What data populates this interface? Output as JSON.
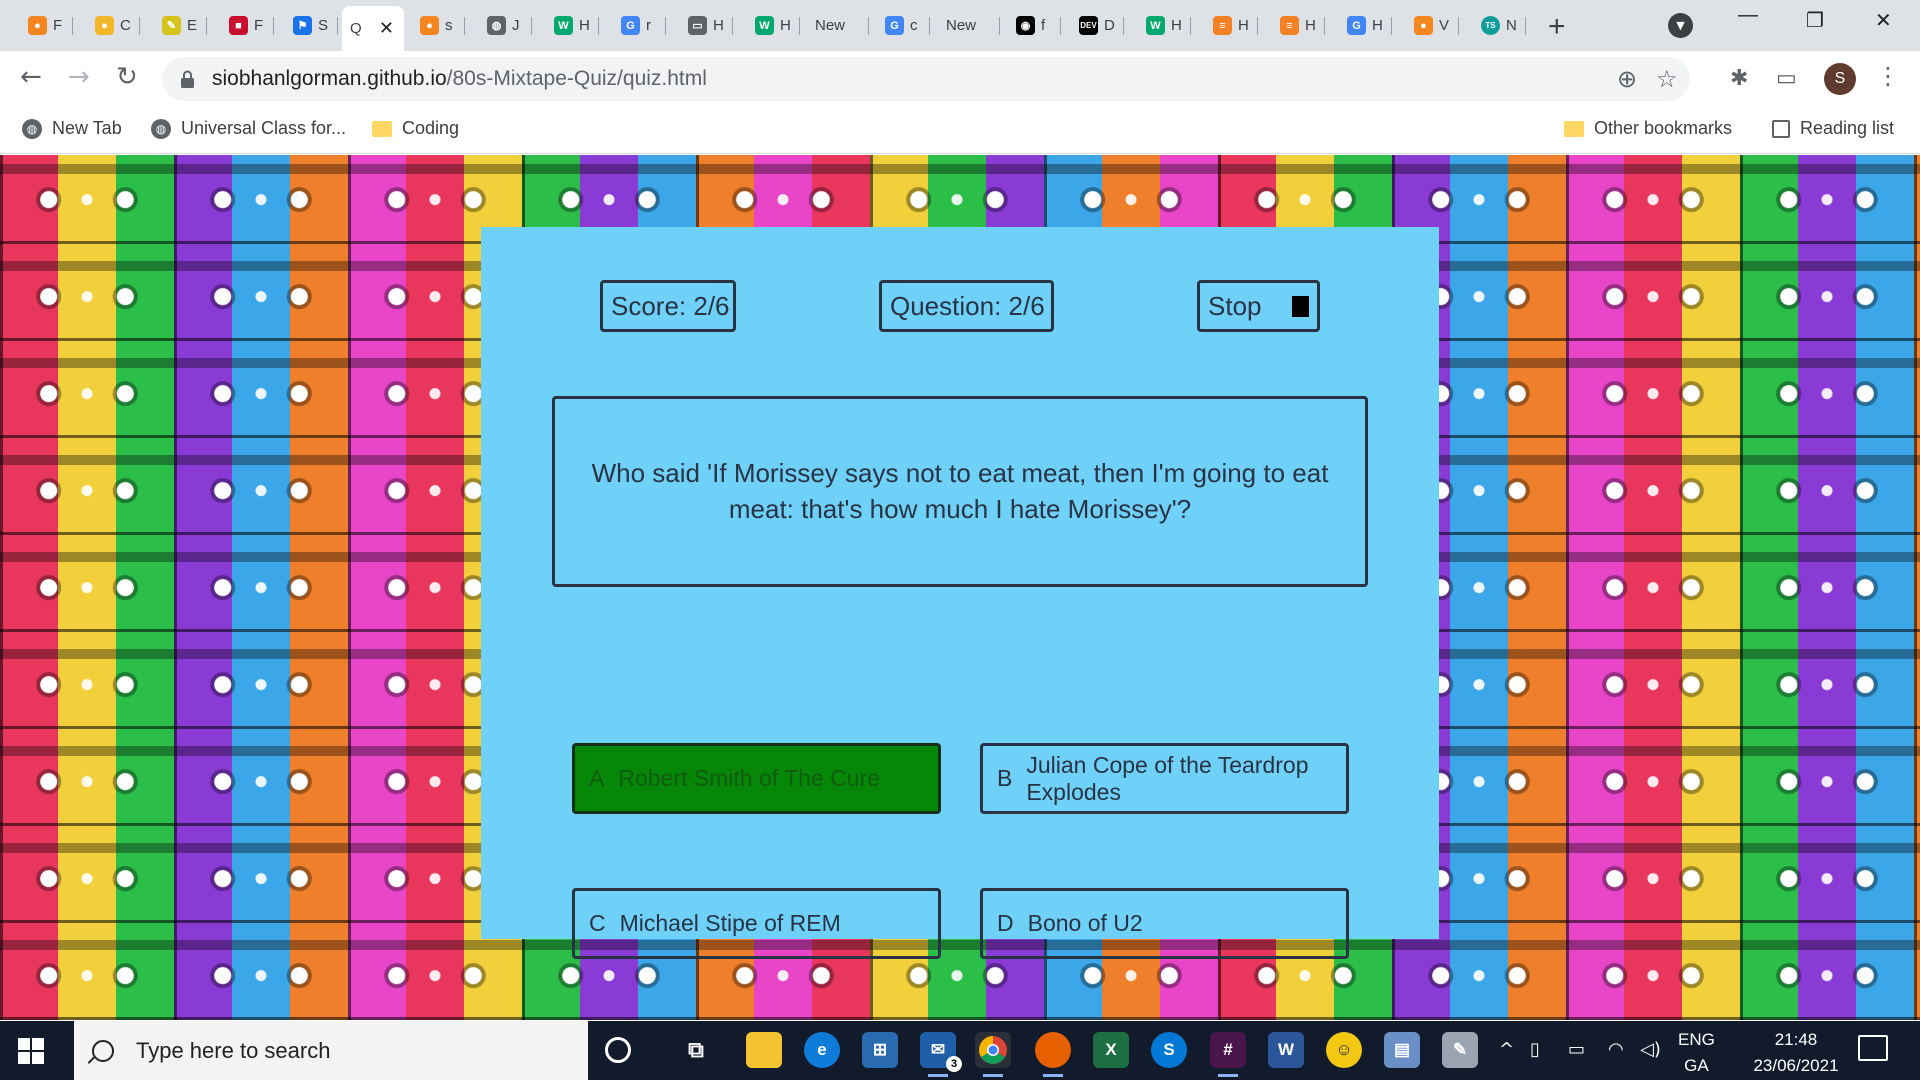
{
  "browser": {
    "tabs": [
      {
        "label": "F",
        "icon": "orange-fire-favicon",
        "color": "#f4861f"
      },
      {
        "label": "C",
        "icon": "codecademy-favicon",
        "color": "#f2b82b"
      },
      {
        "label": "E",
        "icon": "pen-favicon",
        "color": "#d6c31c"
      },
      {
        "label": "F",
        "icon": "flag-favicon",
        "color": "#c8102e"
      },
      {
        "label": "S",
        "icon": "flag-outline-favicon",
        "color": "#1a73e8"
      },
      {
        "label": "Q",
        "icon": "quiz-favicon",
        "color": "#ffffff",
        "active": true
      },
      {
        "label": "s",
        "icon": "orange-fire-favicon",
        "color": "#f4861f"
      },
      {
        "label": "J",
        "icon": "globe-favicon",
        "color": "#5f6368"
      },
      {
        "label": "H",
        "icon": "w3schools-favicon",
        "color": "#04aa6d"
      },
      {
        "label": "r",
        "icon": "google-favicon",
        "color": "#4285f4"
      },
      {
        "label": "H",
        "icon": "keyboard-favicon",
        "color": "#5f6368"
      },
      {
        "label": "H",
        "icon": "w3schools-favicon",
        "color": "#04aa6d"
      },
      {
        "label": "New",
        "icon": "",
        "color": ""
      },
      {
        "label": "c",
        "icon": "google-favicon",
        "color": "#4285f4"
      },
      {
        "label": "New",
        "icon": "",
        "color": ""
      },
      {
        "label": "f",
        "icon": "github-favicon",
        "color": "#000000"
      },
      {
        "label": "D",
        "icon": "dev-favicon",
        "color": "#000000"
      },
      {
        "label": "H",
        "icon": "w3schools-favicon",
        "color": "#04aa6d"
      },
      {
        "label": "H",
        "icon": "stackoverflow-favicon",
        "color": "#f48024"
      },
      {
        "label": "H",
        "icon": "stackoverflow-favicon",
        "color": "#f48024"
      },
      {
        "label": "H",
        "icon": "google-favicon",
        "color": "#4285f4"
      },
      {
        "label": "V",
        "icon": "orange-fire-favicon",
        "color": "#f4861f"
      },
      {
        "label": "N",
        "icon": "ts-favicon",
        "color": "#0f9d9a"
      }
    ],
    "url_host": "siobhanlgorman.github.io",
    "url_path": "/80s-Mixtape-Quiz/quiz.html",
    "profile_initial": "S",
    "bookmarks": [
      {
        "label": "New Tab",
        "icon": "globe-icon"
      },
      {
        "label": "Universal Class for...",
        "icon": "globe-icon"
      },
      {
        "label": "Coding",
        "icon": "folder-icon"
      }
    ],
    "bookmarks_right": [
      {
        "label": "Other bookmarks",
        "icon": "folder-icon"
      },
      {
        "label": "Reading list",
        "icon": "reading-list-icon"
      }
    ]
  },
  "quiz": {
    "score": "Score: 2/6",
    "question_counter": "Question: 2/6",
    "stop_label": "Stop",
    "question": "Who said 'If Morissey says not to eat meat, then I'm going to eat meat: that's how much I hate Morissey'?",
    "answers": [
      {
        "letter": "A",
        "text": "Robert Smith of The Cure",
        "state": "correct"
      },
      {
        "letter": "B",
        "text": "Julian Cope of the Teardrop Explodes",
        "state": "default"
      },
      {
        "letter": "C",
        "text": "Michael Stipe of REM",
        "state": "default"
      },
      {
        "letter": "D",
        "text": "Bono of U2",
        "state": "default"
      }
    ],
    "colors": {
      "panel": "#6fd0f8",
      "border": "#283344",
      "correct": "#078707"
    }
  },
  "taskbar": {
    "search_placeholder": "Type here to search",
    "mail_badge": "3",
    "language": "ENG",
    "region": "GA",
    "time": "21:48",
    "date": "23/06/2021"
  }
}
